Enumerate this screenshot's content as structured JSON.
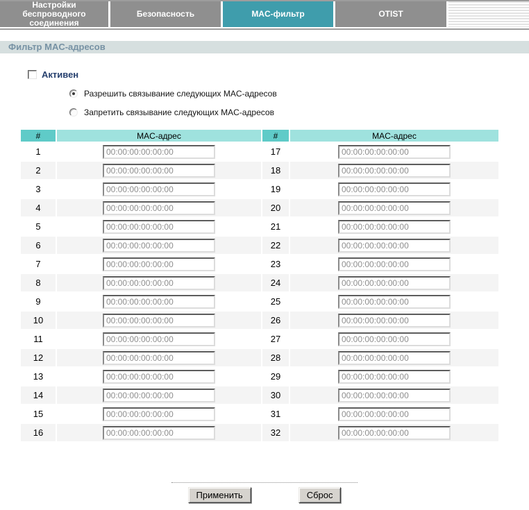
{
  "tabs": [
    {
      "label": "Настройки беспроводного соединения",
      "active": false
    },
    {
      "label": "Безопасность",
      "active": false
    },
    {
      "label": "MAC-фильтр",
      "active": true
    },
    {
      "label": "OTIST",
      "active": false
    }
  ],
  "page_title": "Фильтр MAC-адресов",
  "filter": {
    "active_checkbox_label": "Активен",
    "active_checked": false,
    "radio_options": [
      {
        "label": "Разрешить связывание следующих MAC-адресов",
        "selected": true
      },
      {
        "label": "Запретить связывание следующих MAC-адресов",
        "selected": false
      }
    ]
  },
  "table": {
    "headers": [
      "#",
      "MAC-адрес",
      "#",
      "MAC-адрес"
    ],
    "rows": [
      {
        "left_index": "1",
        "left_value": "00:00:00:00:00:00",
        "right_index": "17",
        "right_value": "00:00:00:00:00:00"
      },
      {
        "left_index": "2",
        "left_value": "00:00:00:00:00:00",
        "right_index": "18",
        "right_value": "00:00:00:00:00:00"
      },
      {
        "left_index": "3",
        "left_value": "00:00:00:00:00:00",
        "right_index": "19",
        "right_value": "00:00:00:00:00:00"
      },
      {
        "left_index": "4",
        "left_value": "00:00:00:00:00:00",
        "right_index": "20",
        "right_value": "00:00:00:00:00:00"
      },
      {
        "left_index": "5",
        "left_value": "00:00:00:00:00:00",
        "right_index": "21",
        "right_value": "00:00:00:00:00:00"
      },
      {
        "left_index": "6",
        "left_value": "00:00:00:00:00:00",
        "right_index": "22",
        "right_value": "00:00:00:00:00:00"
      },
      {
        "left_index": "7",
        "left_value": "00:00:00:00:00:00",
        "right_index": "23",
        "right_value": "00:00:00:00:00:00"
      },
      {
        "left_index": "8",
        "left_value": "00:00:00:00:00:00",
        "right_index": "24",
        "right_value": "00:00:00:00:00:00"
      },
      {
        "left_index": "9",
        "left_value": "00:00:00:00:00:00",
        "right_index": "25",
        "right_value": "00:00:00:00:00:00"
      },
      {
        "left_index": "10",
        "left_value": "00:00:00:00:00:00",
        "right_index": "26",
        "right_value": "00:00:00:00:00:00"
      },
      {
        "left_index": "11",
        "left_value": "00:00:00:00:00:00",
        "right_index": "27",
        "right_value": "00:00:00:00:00:00"
      },
      {
        "left_index": "12",
        "left_value": "00:00:00:00:00:00",
        "right_index": "28",
        "right_value": "00:00:00:00:00:00"
      },
      {
        "left_index": "13",
        "left_value": "00:00:00:00:00:00",
        "right_index": "29",
        "right_value": "00:00:00:00:00:00"
      },
      {
        "left_index": "14",
        "left_value": "00:00:00:00:00:00",
        "right_index": "30",
        "right_value": "00:00:00:00:00:00"
      },
      {
        "left_index": "15",
        "left_value": "00:00:00:00:00:00",
        "right_index": "31",
        "right_value": "00:00:00:00:00:00"
      },
      {
        "left_index": "16",
        "left_value": "00:00:00:00:00:00",
        "right_index": "32",
        "right_value": "00:00:00:00:00:00"
      }
    ]
  },
  "buttons": {
    "apply": "Применить",
    "reset": "Сброс"
  },
  "colors": {
    "tab_inactive": "#8f8f8f",
    "tab_active": "#3f9dac",
    "title_bar_bg": "#d6dfdf",
    "title_text": "#7792a4",
    "checkbox_label": "#26406e",
    "header_num_bg": "#5fcbc8",
    "header_mac_bg": "#9fe2de",
    "row_alt_bg": "#f4f4f4"
  }
}
